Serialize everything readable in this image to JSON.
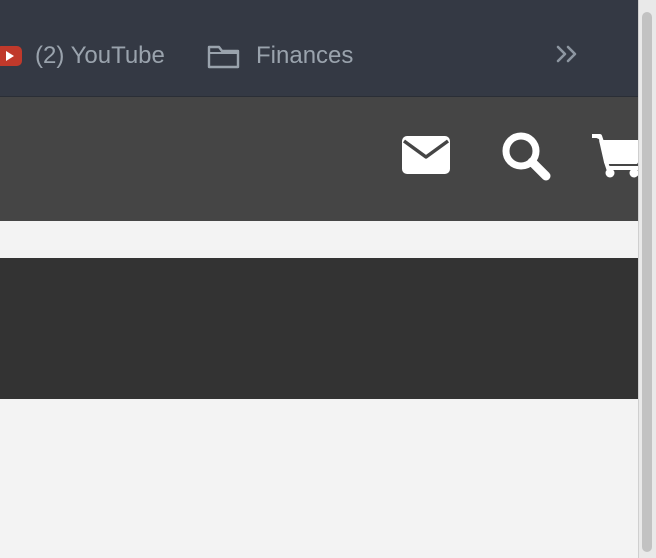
{
  "bookmarks_bar": {
    "items": [
      {
        "label": "(2) YouTube",
        "icon": "youtube-icon"
      },
      {
        "label": "Finances",
        "icon": "folder-icon"
      }
    ],
    "overflow_icon": "double-chevron-right-icon"
  },
  "header": {
    "icons": [
      "envelope-icon",
      "search-icon",
      "shopping-cart-icon"
    ]
  },
  "colors": {
    "bookmarks_bar_bg": "#343944",
    "bookmark_text": "#9aa3ad",
    "youtube_red": "#c0392b",
    "header_bg": "#454545",
    "banner_bg": "#333333",
    "page_bg": "#f3f3f3"
  }
}
